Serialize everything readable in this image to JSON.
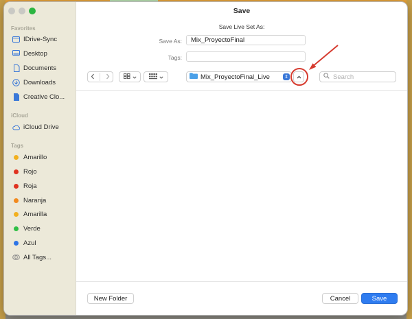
{
  "dialog": {
    "title": "Save",
    "subtitle": "Save Live Set As:",
    "save_as_label": "Save As:",
    "save_as_value": "Mix_ProyectoFinal",
    "tags_label": "Tags:",
    "tags_value": ""
  },
  "toolbar": {
    "back_icon": "chevron-left-icon",
    "forward_icon": "chevron-right-icon",
    "current_folder": "Mix_ProyectoFinal_Live",
    "search_placeholder": "Search"
  },
  "sidebar": {
    "favorites_heading": "Favorites",
    "favorites": [
      {
        "label": "IDrive-Sync",
        "icon": "folder-icon"
      },
      {
        "label": "Desktop",
        "icon": "desktop-icon"
      },
      {
        "label": "Documents",
        "icon": "document-icon"
      },
      {
        "label": "Downloads",
        "icon": "download-icon"
      },
      {
        "label": "Creative Clo...",
        "icon": "file-icon"
      }
    ],
    "icloud_heading": "iCloud",
    "icloud": [
      {
        "label": "iCloud Drive",
        "icon": "cloud-icon"
      }
    ],
    "tags_heading": "Tags",
    "tags": [
      {
        "label": "Amarillo",
        "color": "#f2b01e"
      },
      {
        "label": "Rojo",
        "color": "#e0321f"
      },
      {
        "label": "Roja",
        "color": "#e0321f"
      },
      {
        "label": "Naranja",
        "color": "#f28a1e"
      },
      {
        "label": "Amarilla",
        "color": "#f2b01e"
      },
      {
        "label": "Verde",
        "color": "#2fbf45"
      },
      {
        "label": "Azul",
        "color": "#2c74e6"
      },
      {
        "label": "All Tags...",
        "color": ""
      }
    ]
  },
  "footer": {
    "new_folder_label": "New Folder",
    "cancel_label": "Cancel",
    "save_label": "Save"
  },
  "colors": {
    "accent": "#2f7cf0",
    "annotation": "#d63b2f"
  }
}
